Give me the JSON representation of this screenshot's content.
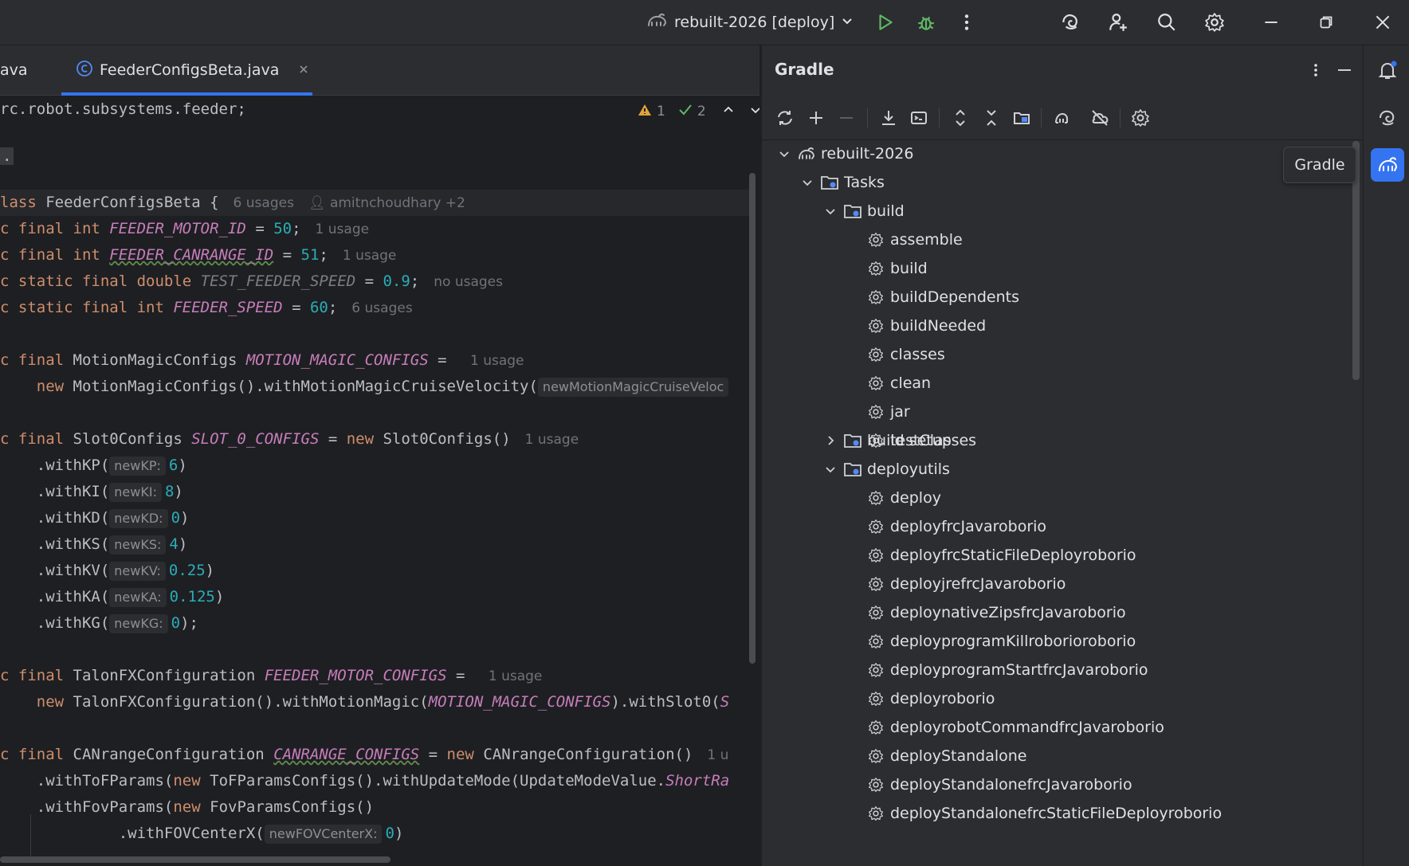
{
  "titlebar": {
    "run_config": "rebuilt-2026 [deploy]",
    "icons": [
      "gradle-elephant-icon",
      "run-icon",
      "debug-icon",
      "more-icon",
      "ai-assistant-icon",
      "add-user-icon",
      "search-icon",
      "settings-icon",
      "minimize-icon",
      "restore-icon",
      "close-icon"
    ]
  },
  "editor": {
    "tabs": [
      {
        "label": "ava",
        "active": false
      },
      {
        "label": "FeederConfigsBeta.java",
        "active": true
      }
    ],
    "inspections": {
      "warnings": "1",
      "checks": "2"
    },
    "lines": {
      "l1": "rc.robot.subsystems.feeder;",
      "l2": ".",
      "l3_code_a": "lass FeederConfigsBeta {",
      "l3_usages": "6 usages",
      "l3_author": "amitnchoudhary +2",
      "l4_prefix": "c final int ",
      "l4_const": "FEEDER_MOTOR_ID",
      "l4_eq": " = ",
      "l4_val": "50",
      "l4_end": ";",
      "l4_hint": "1 usage",
      "l5_prefix": "c final int ",
      "l5_const": "FEEDER_CANRANGE_ID",
      "l5_val": "51",
      "l5_hint": "1 usage",
      "l6_prefix": "c static final double ",
      "l6_const": "TEST_FEEDER_SPEED",
      "l6_val": "0.9",
      "l6_hint": "no usages",
      "l7_prefix": "c static final int ",
      "l7_const": "FEEDER_SPEED",
      "l7_val": "60",
      "l7_hint": "6 usages",
      "l8_prefix": "c final MotionMagicConfigs ",
      "l8_const": "MOTION_MAGIC_CONFIGS",
      "l8_hint": "1 usage",
      "l9_new": "new",
      "l9_code": " MotionMagicConfigs().withMotionMagicCruiseVelocity(",
      "l9_param": "newMotionMagicCruiseVeloc",
      "l10_prefix": "c final Slot0Configs ",
      "l10_const": "SLOT_0_CONFIGS",
      "l10_new": "new",
      "l10_code": " Slot0Configs()",
      "l10_hint": "1 usage",
      "slot_calls": [
        {
          "method": ".withKP(",
          "param": "newKP:",
          "val": "6",
          "end": ")"
        },
        {
          "method": ".withKI(",
          "param": "newKI:",
          "val": "8",
          "end": ")"
        },
        {
          "method": ".withKD(",
          "param": "newKD:",
          "val": "0",
          "end": ")"
        },
        {
          "method": ".withKS(",
          "param": "newKS:",
          "val": "4",
          "end": ")"
        },
        {
          "method": ".withKV(",
          "param": "newKV:",
          "val": "0.25",
          "end": ")"
        },
        {
          "method": ".withKA(",
          "param": "newKA:",
          "val": "0.125",
          "end": ")"
        },
        {
          "method": ".withKG(",
          "param": "newKG:",
          "val": "0",
          "end": ");"
        }
      ],
      "l18_prefix": "c final TalonFXConfiguration ",
      "l18_const": "FEEDER_MOTOR_CONFIGS",
      "l18_hint": "1 usage",
      "l19_new": "new",
      "l19_code": " TalonFXConfiguration().withMotionMagic(",
      "l19_const": "MOTION_MAGIC_CONFIGS",
      "l19_end": ").withSlot0(",
      "l19_tail": "S",
      "l20_prefix": "c final CANrangeConfiguration ",
      "l20_const": "CANRANGE_CONFIGS",
      "l20_new": "new",
      "l20_code": " CANrangeConfiguration()",
      "l20_hint": "1 u",
      "l21_code": ".withToFParams(",
      "l21_new": "new",
      "l21_code2": " ToFParamsConfigs().withUpdateMode(UpdateModeValue.",
      "l21_const": "ShortRa",
      "l22_code": ".withFovParams(",
      "l22_new": "new",
      "l22_code2": " FovParamsConfigs()",
      "l23_code": ".withFOVCenterX(",
      "l23_param": "newFOVCenterX:",
      "l23_val": "0",
      "l23_end": ")"
    }
  },
  "gradle": {
    "title": "Gradle",
    "tooltip": "Gradle",
    "toolbar_icons": [
      "refresh-icon",
      "add-icon",
      "remove-icon",
      "download-icon",
      "execute-task-icon",
      "expand-all-icon",
      "collapse-all-icon",
      "group-modules-icon",
      "analyze-dependencies-icon",
      "offline-mode-icon",
      "gradle-settings-icon"
    ],
    "tree": {
      "root": "rebuilt-2026",
      "tasks": "Tasks",
      "build_group": "build",
      "build_tasks": [
        "assemble",
        "build",
        "buildDependents",
        "buildNeeded",
        "classes",
        "clean",
        "jar",
        "testClasses"
      ],
      "build_setup_group": "build setup",
      "deployutils_group": "deployutils",
      "deployutils_tasks": [
        "deploy",
        "deployfrcJavaroborio",
        "deployfrcStaticFileDeployroborio",
        "deployjrefrcJavaroborio",
        "deploynativeZipsfrcJavaroborio",
        "deployprogramKillroborioroborio",
        "deployprogramStartfrcJavaroborio",
        "deployroborio",
        "deployrobotCommandfrcJavaroborio",
        "deployStandalone",
        "deployStandalonefrcJavaroborio",
        "deployStandalonefrcStaticFileDeployroborio"
      ]
    }
  },
  "colors": {
    "accent": "#3574f0",
    "keyword": "#cf8e6d",
    "constant": "#c77dbb",
    "number": "#2aacb8",
    "run_green": "#5fb865"
  }
}
